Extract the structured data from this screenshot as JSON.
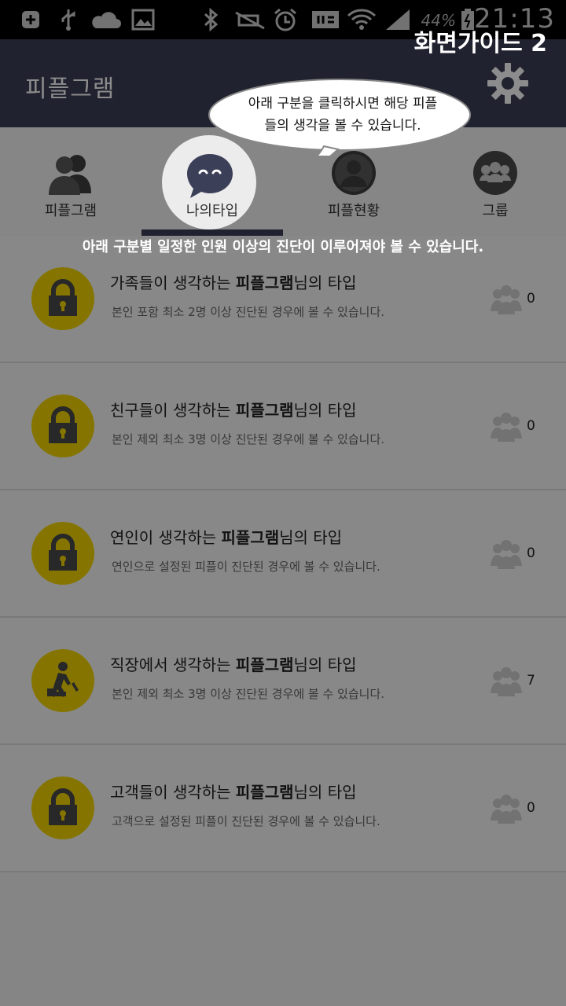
{
  "status_bar": {
    "time": "21:13",
    "battery": "44%",
    "icons": [
      "add-icon",
      "usb-icon",
      "cloud-icon",
      "image-icon",
      "bluetooth-icon",
      "mute-icon",
      "alarm-icon",
      "data-sync-icon",
      "wifi-icon",
      "signal-icon",
      "battery-icon"
    ]
  },
  "app_bar": {
    "title": "피플그램",
    "settings_icon": "gear-icon"
  },
  "tabs": [
    {
      "label": "피플그램",
      "icon": "people-icon"
    },
    {
      "label": "나의타입",
      "icon": "chat-face-icon",
      "selected": true
    },
    {
      "label": "피플현황",
      "icon": "person-icon"
    },
    {
      "label": "그룹",
      "icon": "group-icon"
    }
  ],
  "guide": {
    "title": "화면가이드 2",
    "bubble_line1": "아래 구분을 클릭하시면 해당 피플",
    "bubble_line2": "들의 생각을 볼 수 있습니다.",
    "note": "아래 구분별 일정한 인원 이상의 진단이 이루어져야 볼 수 있습니다."
  },
  "rows": [
    {
      "pre": "가족들이 생각하는 ",
      "bold": "피플그램",
      "post": "님의 타입",
      "sub": "본인 포함 최소 2명 이상 진단된 경우에 볼 수 있습니다.",
      "count": "0",
      "icon": "lock-icon"
    },
    {
      "pre": "친구들이 생각하는 ",
      "bold": "피플그램",
      "post": "님의 타입",
      "sub": "본인 제외 최소 3명 이상 진단된 경우에 볼 수 있습니다.",
      "count": "0",
      "icon": "lock-icon"
    },
    {
      "pre": "연인이 생각하는 ",
      "bold": "피플그램",
      "post": "님의 타입",
      "sub": "연인으로 설정된 피플이 진단된 경우에 볼 수 있습니다.",
      "count": "0",
      "icon": "lock-icon"
    },
    {
      "pre": "직장에서 생각하는 ",
      "bold": "피플그램",
      "post": "님의 타입",
      "sub": "본인 제외 최소 3명 이상 진단된 경우에 볼 수 있습니다.",
      "count": "7",
      "icon": "construction-icon"
    },
    {
      "pre": "고객들이 생각하는 ",
      "bold": "피플그램",
      "post": "님의 타입",
      "sub": "고객으로 설정된 피플이 진단된 경우에 볼 수 있습니다.",
      "count": "0",
      "icon": "lock-icon"
    }
  ],
  "colors": {
    "app_bar": "#3b3f58",
    "lock_bg": "#f3d600",
    "indicator": "#3b3f58"
  }
}
